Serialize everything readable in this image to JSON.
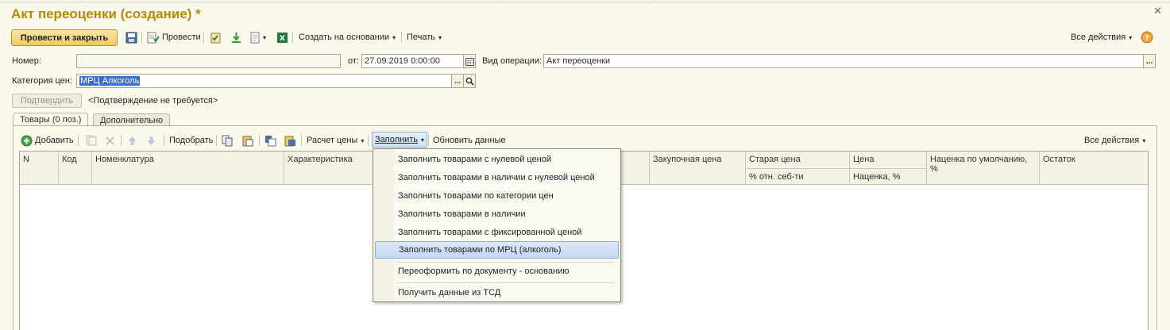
{
  "title": "Акт переоценки (создание) *",
  "toolbar": {
    "post_close": "Провести и закрыть",
    "post": "Провести",
    "create_based": "Создать на основании",
    "print": "Печать",
    "all_actions": "Все действия"
  },
  "header_fields": {
    "number_label": "Номер:",
    "number_value": "",
    "date_label": "от:",
    "date_value": "27.09.2019  0:00:00",
    "operation_label": "Вид операции:",
    "operation_value": "Акт переоценки",
    "price_category_label": "Категория цен:",
    "price_category_value": "МРЦ Алкоголь",
    "confirm_button": "Подтвердить",
    "confirm_status": "<Подтверждение не требуется>"
  },
  "tabs": [
    {
      "label": "Товары (0 поз.)",
      "active": true
    },
    {
      "label": "Дополнительно",
      "active": false
    }
  ],
  "table_toolbar": {
    "add": "Добавить",
    "pick": "Подобрать",
    "price_calc": "Расчет цены",
    "fill": "Заполнить",
    "refresh": "Обновить данные",
    "all_actions": "Все действия"
  },
  "columns": {
    "n": "N",
    "code": "Код",
    "nomenclature": "Номенклатура",
    "characteristic": "Характеристика",
    "purchase_price": "Закупочная цена",
    "old_price": "Старая цена",
    "old_price_sub": "% отн. себ-ти",
    "price": "Цена",
    "price_sub": "Наценка, %",
    "default_markup": "Наценка по умолчанию, %",
    "remainder": "Остаток"
  },
  "fill_menu": [
    "Заполнить товарами с нулевой ценой",
    "Заполнить товарами в наличии с нулевой ценой",
    "Заполнить товарами по категории цен",
    "Заполнить товарами в наличии",
    "Заполнить товарами с фиксированной ценой",
    "Заполнить товарами по МРЦ (алкоголь)",
    "Переоформить по документу - основанию",
    "Получить данные из ТСД"
  ],
  "colors": {
    "title": "#b8860b",
    "highlight": "#c3d8f1",
    "background": "#fbf9ec"
  }
}
